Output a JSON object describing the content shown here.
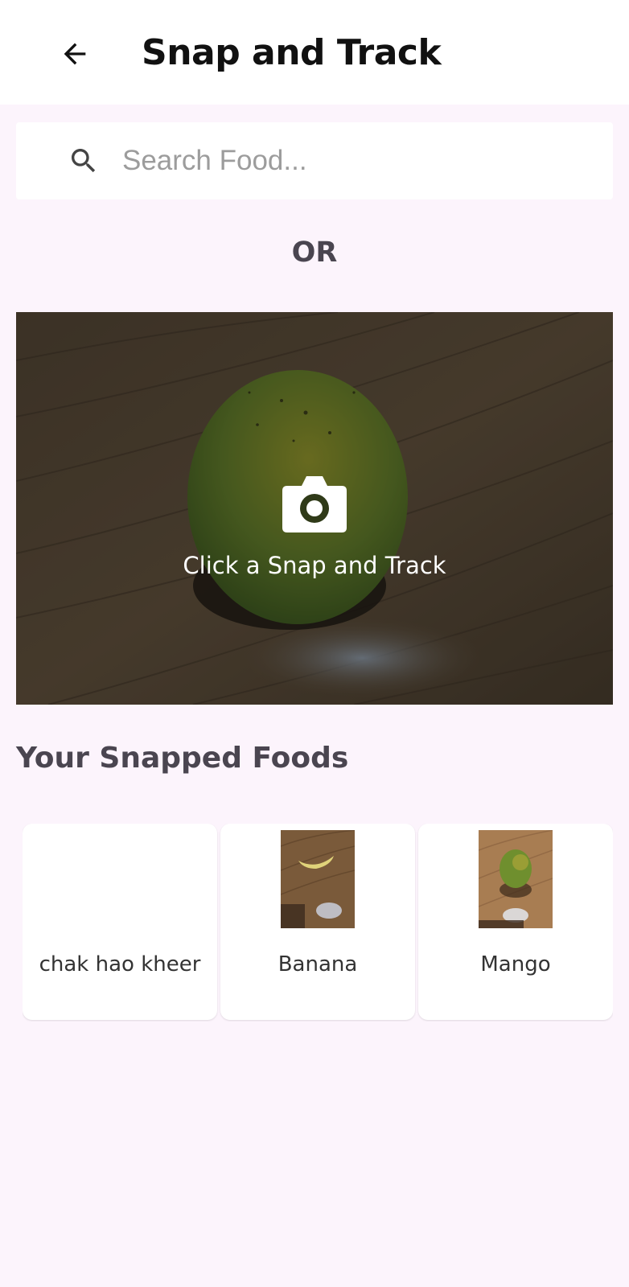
{
  "app_bar": {
    "title": "Snap and Track",
    "back_icon": "arrow-left-icon"
  },
  "search": {
    "placeholder": "Search Food...",
    "value": "",
    "icon": "search-icon"
  },
  "divider_text": "OR",
  "snap": {
    "label": "Click a Snap and Track",
    "icon": "camera-icon"
  },
  "snapped_foods": {
    "title": "Your Snapped Foods",
    "items": [
      {
        "name": "chak hao kheer"
      },
      {
        "name": "Banana"
      },
      {
        "name": "Mango"
      }
    ]
  },
  "colors": {
    "background": "#fcf4fc",
    "app_bar": "#ffffff",
    "text_primary": "#111111",
    "text_secondary": "#4a4550"
  }
}
